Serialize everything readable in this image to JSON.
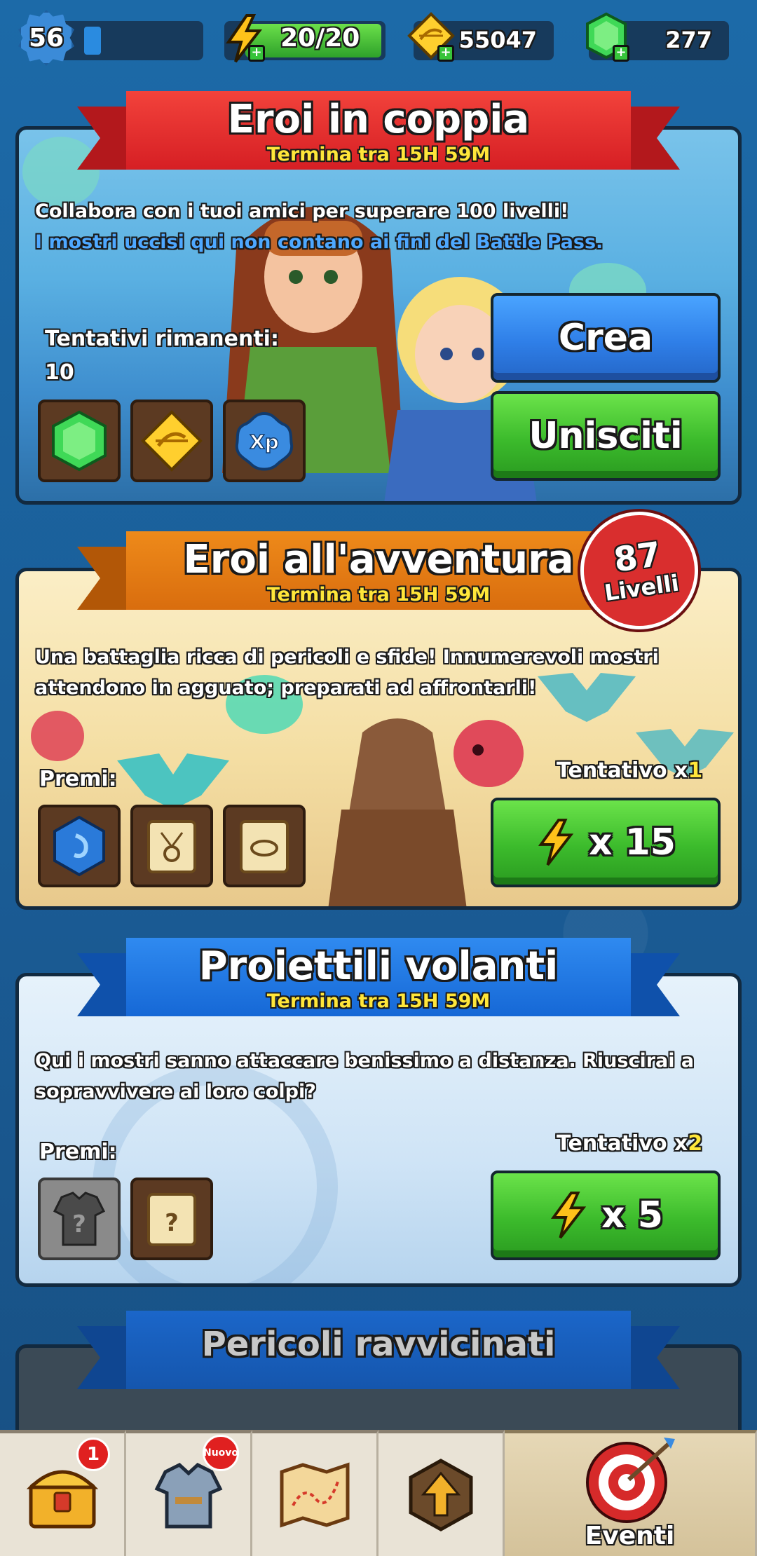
{
  "topbar": {
    "level": "56",
    "energy": "20/20",
    "gold": "55047",
    "gems": "277"
  },
  "events": [
    {
      "title": "Eroi in coppia",
      "timer": "Termina tra 15H 59M",
      "description": "Collabora con i tuoi amici per superare 100 livelli!",
      "note": "I mostri uccisi qui non contano ai fini del Battle Pass.",
      "attempts_label": "Tentativi rimanenti:",
      "attempts_value": "10",
      "create_button": "Crea",
      "join_button": "Unisciti",
      "rewards": [
        "gem-icon",
        "arrow-token-icon",
        "xp-icon"
      ],
      "xp_text": "Xp"
    },
    {
      "title": "Eroi all'avventura",
      "timer": "Termina tra 15H 59M",
      "description_line1": "Una battaglia ricca di pericoli e sfide! Innumerevoli mostri",
      "description_line2": "attendono in agguato; preparati ad affrontarli!",
      "levels_badge_number": "87",
      "levels_badge_label": "Livelli",
      "rewards_label": "Premi:",
      "attempt_prefix": "Tentativo x",
      "attempt_multiplier": "1",
      "cost": "x 15",
      "rewards": [
        "sapphire-icon",
        "amulet-scroll-icon",
        "ring-scroll-icon"
      ]
    },
    {
      "title": "Proiettili volanti",
      "timer": "Termina tra 15H 59M",
      "description_line1": "Qui i mostri sanno attaccare benissimo a distanza. Riuscirai a",
      "description_line2": "sopravvivere ai loro colpi?",
      "rewards_label": "Premi:",
      "attempt_prefix": "Tentativo x",
      "attempt_multiplier": "2",
      "cost": "x 5",
      "rewards": [
        "mystery-armor-icon",
        "mystery-scroll-icon"
      ],
      "mystery_mark": "?"
    },
    {
      "title": "Pericoli ravvicinati"
    }
  ],
  "bottom_nav": {
    "chest_badge": "1",
    "equipment_badge": "Nuovo",
    "active_label": "Eventi"
  },
  "colors": {
    "timer_yellow": "#ffe63a",
    "note_blue": "#4ea8ff",
    "button_green": "#3cbb2c",
    "button_blue": "#2f7fe8"
  }
}
